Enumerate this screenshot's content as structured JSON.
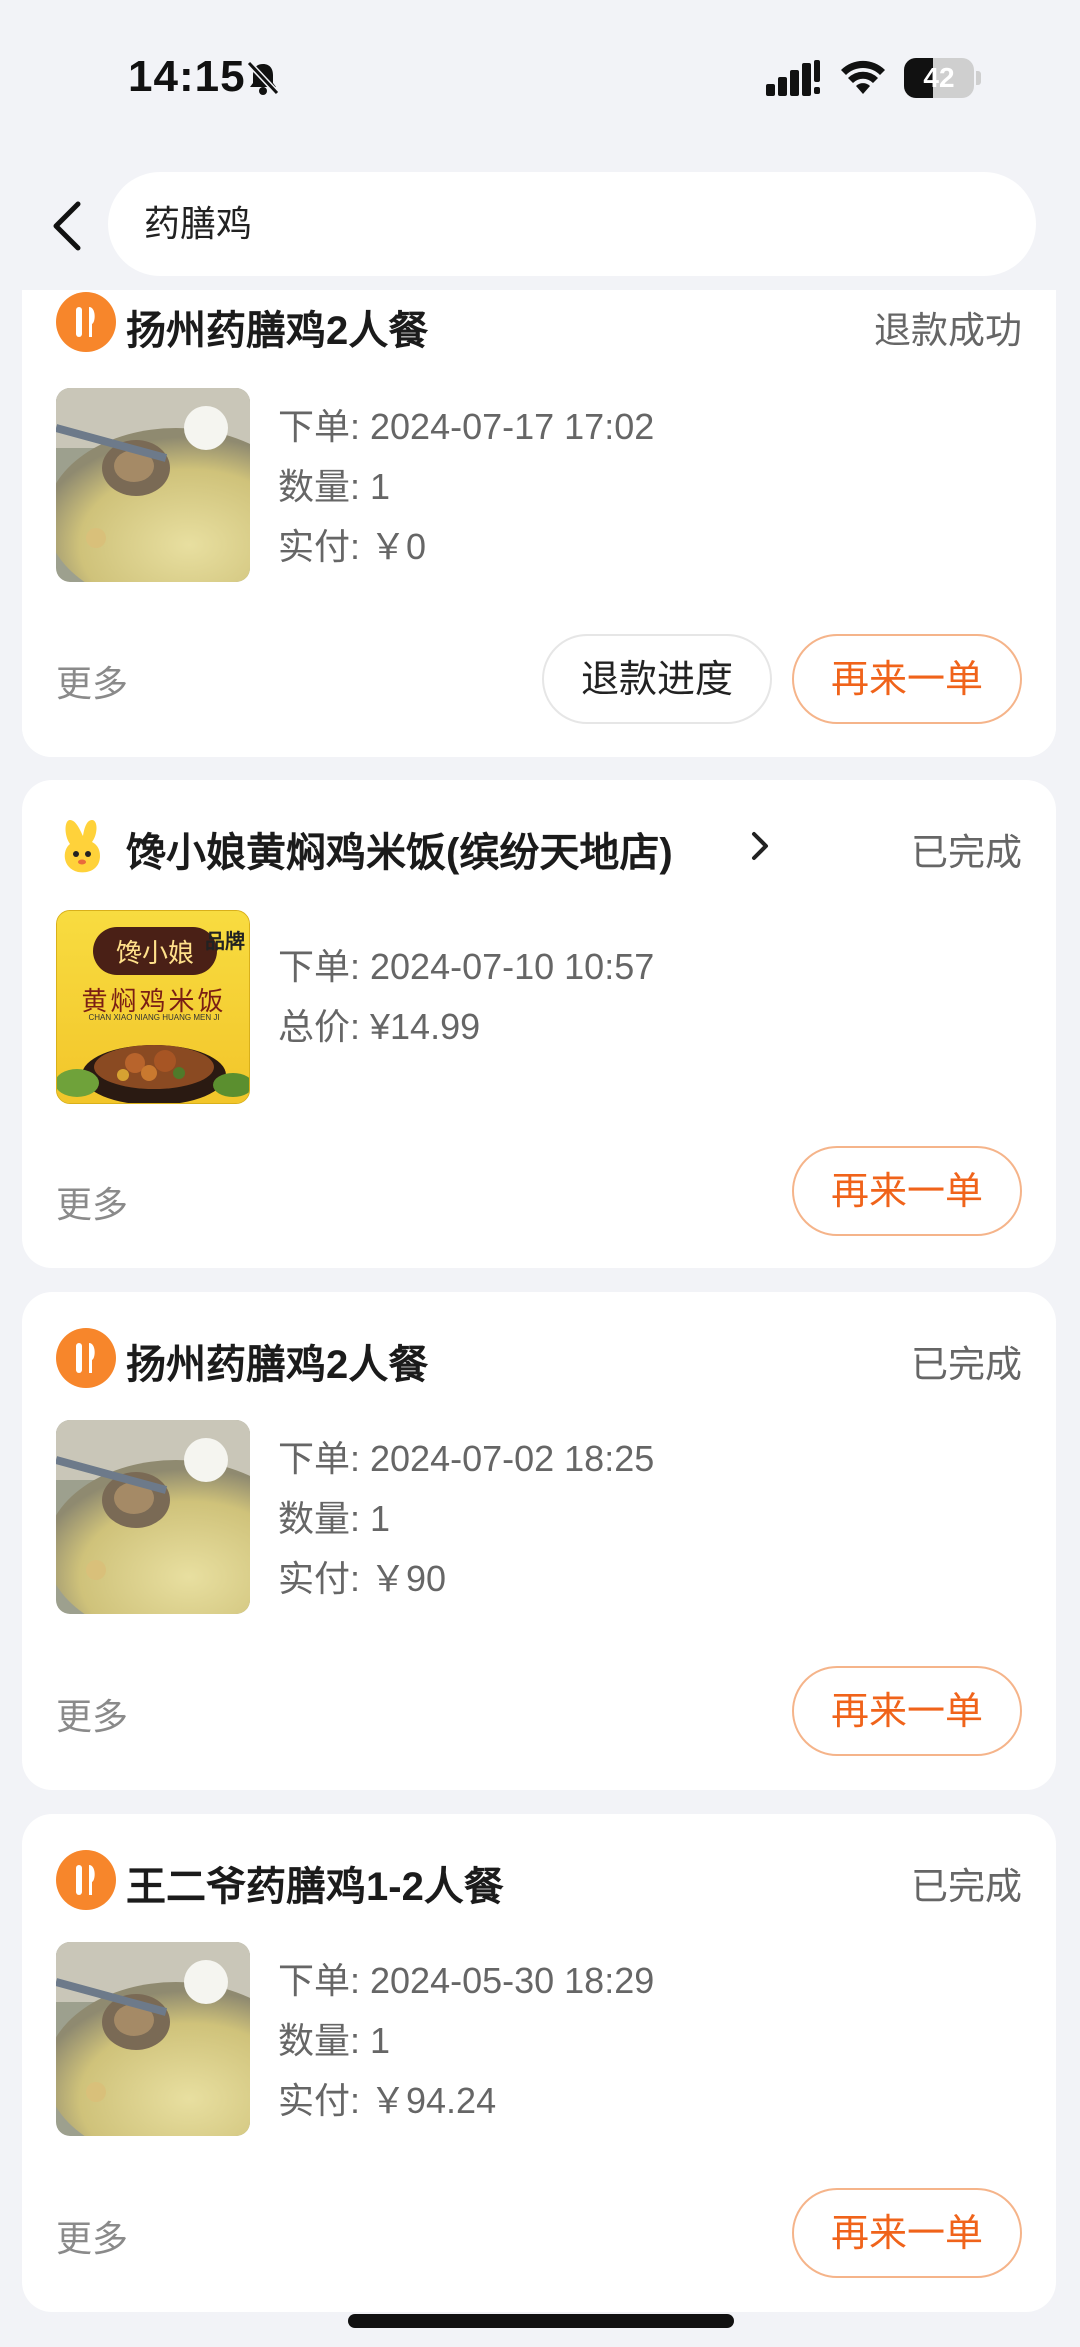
{
  "status_bar": {
    "time": "14:15",
    "battery_level": "42",
    "battery_fraction": 0.42
  },
  "search": {
    "query": "药膳鸡"
  },
  "orders": [
    {
      "store_name": "扬州药膳鸡2人餐",
      "status": "退款成功",
      "order_time": "下单: 2024-07-17 17:02",
      "quantity": "数量: 1",
      "paid": "实付: ￥0",
      "more": "更多",
      "refund_button": "退款进度",
      "reorder_button": "再来一单"
    },
    {
      "store_name": "馋小娘黄焖鸡米饭(缤纷天地店)",
      "status": "已完成",
      "order_time": "下单: 2024-07-10 10:57",
      "total": "总价: ¥14.99",
      "more": "更多",
      "reorder_button": "再来一单",
      "logo_text": "馋小娘",
      "logo_badge": "品牌",
      "logo_subtitle": "黄焖鸡米饭",
      "logo_pinyin": "CHAN XIAO NIANG HUANG MEN JI"
    },
    {
      "store_name": "扬州药膳鸡2人餐",
      "status": "已完成",
      "order_time": "下单: 2024-07-02 18:25",
      "quantity": "数量: 1",
      "paid": "实付: ￥90",
      "more": "更多",
      "reorder_button": "再来一单"
    },
    {
      "store_name": "王二爷药膳鸡1-2人餐",
      "status": "已完成",
      "order_time": "下单: 2024-05-30 18:29",
      "quantity": "数量: 1",
      "paid": "实付: ￥94.24",
      "more": "更多",
      "reorder_button": "再来一单"
    }
  ],
  "colors": {
    "accent": "#f0631a",
    "icon_orange": "#f7862b",
    "background": "#f2f3f7"
  }
}
